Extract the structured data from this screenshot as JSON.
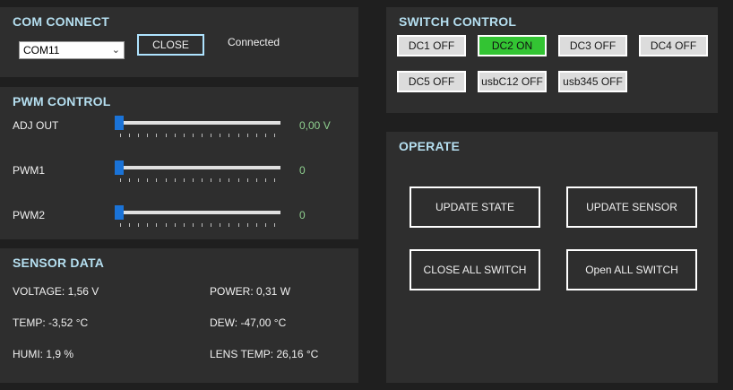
{
  "com": {
    "title": "COM CONNECT",
    "port": "COM11",
    "close_label": "CLOSE",
    "status": "Connected"
  },
  "pwm": {
    "title": "PWM CONTROL",
    "rows": [
      {
        "label": "ADJ OUT",
        "value": "0,00 V",
        "level": 0
      },
      {
        "label": "PWM1",
        "value": "0",
        "level": 0
      },
      {
        "label": "PWM2",
        "value": "0",
        "level": 0
      }
    ]
  },
  "sensor": {
    "title": "SENSOR DATA",
    "voltage": "VOLTAGE: 1,56 V",
    "power": "POWER: 0,31 W",
    "temp": "TEMP: -3,52 °C",
    "dew": "DEW: -47,00 °C",
    "humi": "HUMI: 1,9 %",
    "lens_temp": "LENS TEMP: 26,16 °C"
  },
  "switch": {
    "title": "SWITCH CONTROL",
    "buttons": [
      {
        "label": "DC1 OFF",
        "on": false
      },
      {
        "label": "DC2 ON",
        "on": true
      },
      {
        "label": "DC3 OFF",
        "on": false
      },
      {
        "label": "DC4 OFF",
        "on": false
      },
      {
        "label": "DC5 OFF",
        "on": false
      },
      {
        "label": "usbC12 OFF",
        "on": false
      },
      {
        "label": "usb345 OFF",
        "on": false
      }
    ]
  },
  "operate": {
    "title": "OPERATE",
    "update_state": "UPDATE STATE",
    "update_sensor": "UPDATE SENSOR",
    "close_all": "CLOSE ALL SWITCH",
    "open_all": "Open ALL SWITCH"
  },
  "colors": {
    "title": "#b5dff0",
    "value": "#8fd08f",
    "switch_on": "#33c433",
    "slider_thumb": "#1a73d8"
  }
}
